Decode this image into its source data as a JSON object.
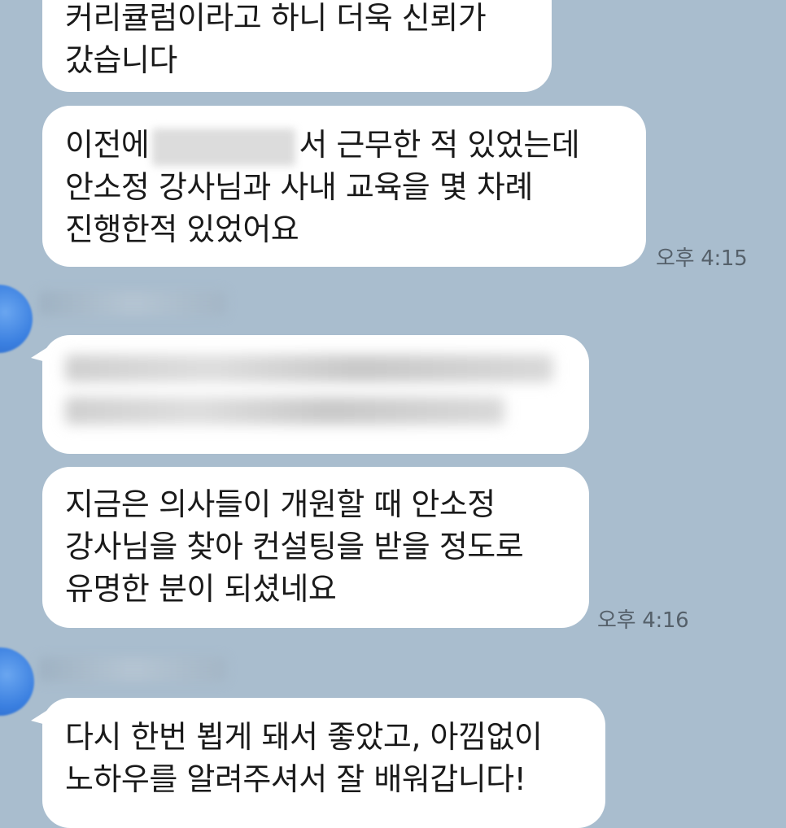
{
  "messages": [
    {
      "lines": [
        "커리큘럼이라고 하니 더욱 신뢰가",
        "갔습니다"
      ]
    },
    {
      "line1_before": "이전에",
      "line1_after": "서 근무한 적 있었는데",
      "line2": "안소정 강사님과 사내 교육을 몇 차례",
      "line3": "진행한적 있었어요",
      "time": "오후 4:15"
    },
    {
      "lines": [
        "지금은 의사들이 개원할 때 안소정",
        "강사님을 찾아 컨설팅을 받을 정도로",
        "유명한 분이 되셨네요"
      ],
      "time": "오후 4:16"
    },
    {
      "lines": [
        "다시 한번 뵙게 돼서 좋았고, 아낌없이",
        "노하우를 알려주셔서 잘 배워갑니다!"
      ]
    }
  ],
  "colors": {
    "background": "#a9bdce",
    "bubble": "#ffffff",
    "avatar": "#3a7fe0"
  }
}
